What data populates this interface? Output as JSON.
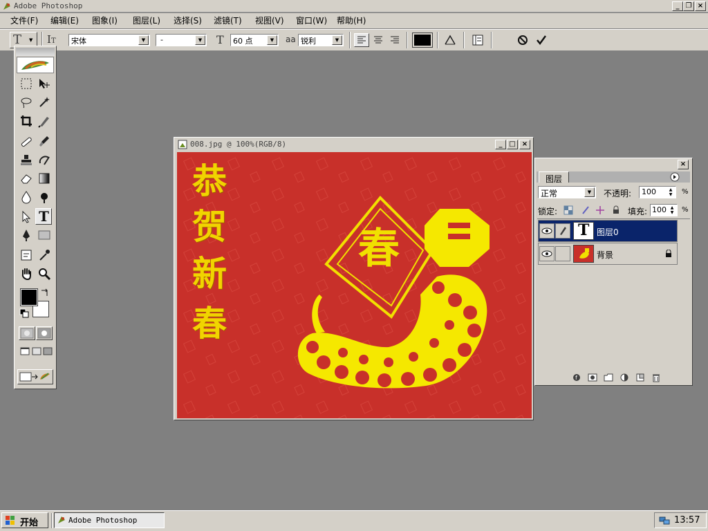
{
  "app": {
    "title": "Adobe Photoshop"
  },
  "menu": [
    {
      "label": "文件(F)"
    },
    {
      "label": "编辑(E)"
    },
    {
      "label": "图象(I)"
    },
    {
      "label": "图层(L)"
    },
    {
      "label": "选择(S)"
    },
    {
      "label": "滤镜(T)"
    },
    {
      "label": "视图(V)"
    },
    {
      "label": "窗口(W)"
    },
    {
      "label": "帮助(H)"
    }
  ],
  "options_bar": {
    "font_family": "宋体",
    "font_style": "-",
    "font_size": "60 点",
    "antialias_label": "aa",
    "antialias": "锐利",
    "color": "#000000"
  },
  "document": {
    "title": "008.jpg @ 100%(RGB/8)",
    "canvas_bg": "#c8302a",
    "banner_chars": [
      "恭",
      "贺",
      "新",
      "春"
    ],
    "diamond_char": "春"
  },
  "layers_panel": {
    "tab": "图层",
    "blend_mode": "正常",
    "opacity_label": "不透明:",
    "opacity": "100",
    "percent": "%",
    "lock_label": "锁定:",
    "fill_label": "填充:",
    "fill": "100",
    "layers": [
      {
        "name": "图层0",
        "thumb": "T",
        "selected": true
      },
      {
        "name": "背景",
        "selected": false
      }
    ]
  },
  "taskbar": {
    "start": "开始",
    "task": "Adobe Photoshop",
    "clock": "13:57"
  }
}
